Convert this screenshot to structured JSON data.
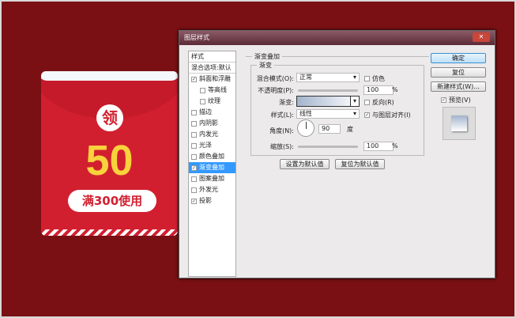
{
  "envelope": {
    "icon_text": "领",
    "amount": "50",
    "condition": "满300使用"
  },
  "dialog": {
    "title": "图层样式",
    "close": "✕",
    "styles_header": "样式",
    "blend_default": "混合选项:默认",
    "items": [
      {
        "label": "斜面和浮雕",
        "checked": true,
        "sub": false
      },
      {
        "label": "等高线",
        "checked": false,
        "sub": true
      },
      {
        "label": "纹理",
        "checked": false,
        "sub": true
      },
      {
        "label": "描边",
        "checked": false,
        "sub": false
      },
      {
        "label": "内阴影",
        "checked": false,
        "sub": false
      },
      {
        "label": "内发光",
        "checked": false,
        "sub": false
      },
      {
        "label": "光泽",
        "checked": false,
        "sub": false
      },
      {
        "label": "颜色叠加",
        "checked": false,
        "sub": false
      },
      {
        "label": "渐变叠加",
        "checked": true,
        "sub": false,
        "selected": true
      },
      {
        "label": "图案叠加",
        "checked": false,
        "sub": false
      },
      {
        "label": "外发光",
        "checked": false,
        "sub": false
      },
      {
        "label": "投影",
        "checked": true,
        "sub": false
      }
    ],
    "section": "渐变叠加",
    "subsection": "渐变",
    "blend_mode_label": "混合模式(O):",
    "blend_mode": "正常",
    "dither": "仿色",
    "opacity_label": "不透明度(P):",
    "opacity": "100",
    "percent": "%",
    "gradient_label": "渐变:",
    "reverse": "反向(R)",
    "style_label": "样式(L):",
    "style": "线性",
    "align": "与图层对齐(I)",
    "angle_label": "角度(N):",
    "angle": "90",
    "degree": "度",
    "scale_label": "缩放(S):",
    "scale": "100",
    "set_default": "设置为默认值",
    "reset_default": "复位为默认值",
    "ok": "确定",
    "reset": "复位",
    "new_style": "新建样式(W)...",
    "preview": "预览(V)"
  }
}
